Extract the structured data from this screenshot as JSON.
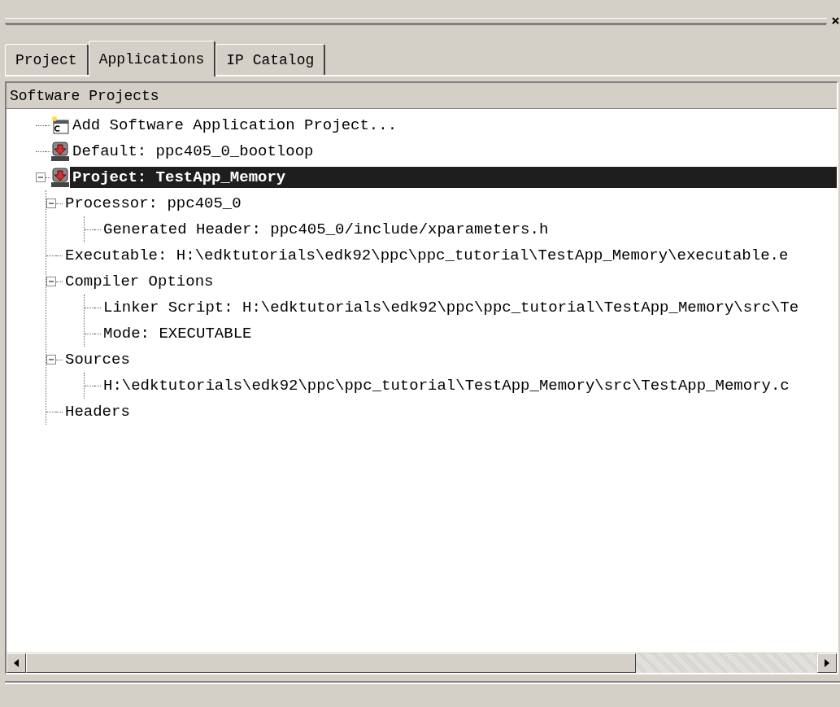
{
  "tabs": [
    {
      "label": "Project",
      "selected": false
    },
    {
      "label": "Applications",
      "selected": true
    },
    {
      "label": "IP Catalog",
      "selected": false
    }
  ],
  "panel": {
    "header": "Software Projects"
  },
  "tree": [
    {
      "label": "Add Software Application Project...",
      "kind": "new-app",
      "selected": false
    },
    {
      "label": "Default: ppc405_0_bootloop",
      "kind": "bram",
      "selected": false
    },
    {
      "label": "Project: TestApp_Memory",
      "kind": "bram",
      "selected": true,
      "expanded": true,
      "children": [
        {
          "label": "Processor: ppc405_0",
          "selected": false,
          "expanded": true,
          "children": [
            {
              "label": "Generated Header: ppc405_0/include/xparameters.h",
              "selected": false
            }
          ]
        },
        {
          "label": "Executable: H:\\edktutorials\\edk92\\ppc\\ppc_tutorial\\TestApp_Memory\\executable.e",
          "selected": false
        },
        {
          "label": "Compiler Options",
          "selected": false,
          "expanded": true,
          "children": [
            {
              "label": "Linker Script: H:\\edktutorials\\edk92\\ppc\\ppc_tutorial\\TestApp_Memory\\src\\Te",
              "selected": false
            },
            {
              "label": "Mode: EXECUTABLE",
              "selected": false
            }
          ]
        },
        {
          "label": "Sources",
          "selected": false,
          "expanded": true,
          "children": [
            {
              "label": "H:\\edktutorials\\edk92\\ppc\\ppc_tutorial\\TestApp_Memory\\src\\TestApp_Memory.c",
              "selected": false
            }
          ]
        },
        {
          "label": "Headers",
          "selected": false
        }
      ]
    }
  ]
}
